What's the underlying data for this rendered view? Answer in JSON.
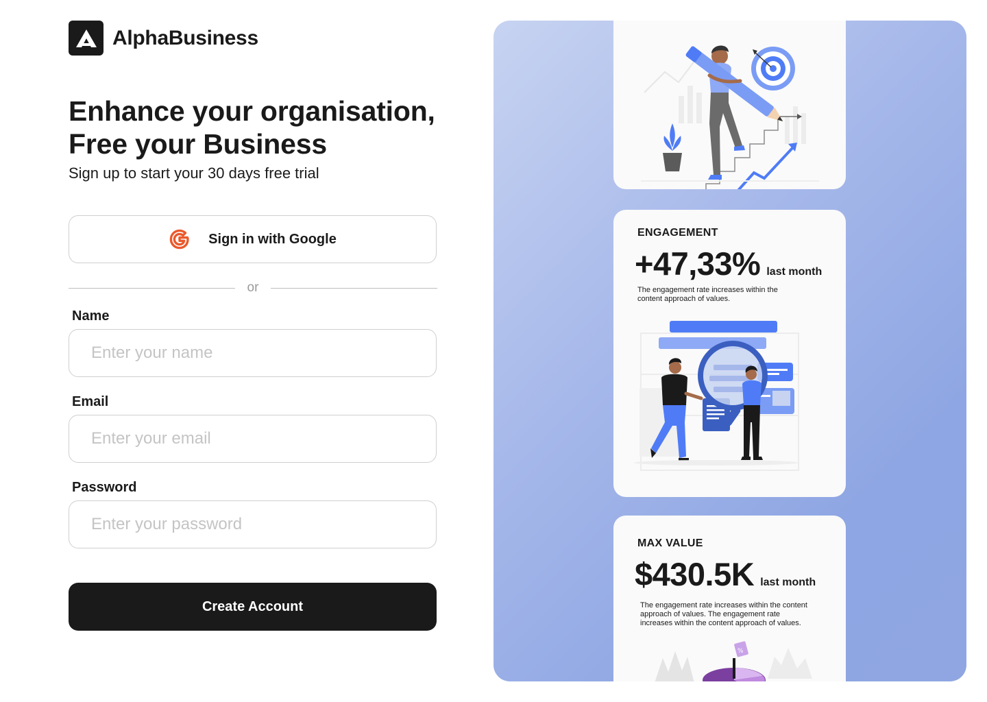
{
  "brand": {
    "name": "AlphaBusiness",
    "logo_icon": "alpha-logo-icon"
  },
  "hero": {
    "headline_line1": "Enhance your organisation,",
    "headline_line2": "Free your Business",
    "subtitle": "Sign up to start your 30 days free trial"
  },
  "google_button": {
    "label": "Sign in with Google",
    "icon": "google-icon",
    "icon_color": "#ea5a2c"
  },
  "divider": {
    "text": "or"
  },
  "form": {
    "name": {
      "label": "Name",
      "placeholder": "Enter your name",
      "value": ""
    },
    "email": {
      "label": "Email",
      "placeholder": "Enter your email",
      "value": ""
    },
    "password": {
      "label": "Password",
      "placeholder": "Enter your password",
      "value": ""
    },
    "submit_label": "Create Account"
  },
  "panel": {
    "colors": {
      "accent": "#4f7cf6",
      "gradient_start": "#c7d3f1",
      "gradient_end": "#8fa6e2",
      "dark": "#1a1a1a"
    },
    "cards": [
      {
        "illustration": "growth-stairs-illustration"
      },
      {
        "title": "ENGAGEMENT",
        "value": "+47,33%",
        "suffix": "last month",
        "description": "The engagement rate increases within the content approach of values.",
        "illustration": "analytics-magnifier-illustration"
      },
      {
        "title": "MAX VALUE",
        "value": "$430.5K",
        "suffix": "last month",
        "description": "The engagement rate increases within the content approach of values.  The engagement rate increases within the content approach of values.",
        "illustration": "pie-chart-illustration"
      }
    ]
  }
}
